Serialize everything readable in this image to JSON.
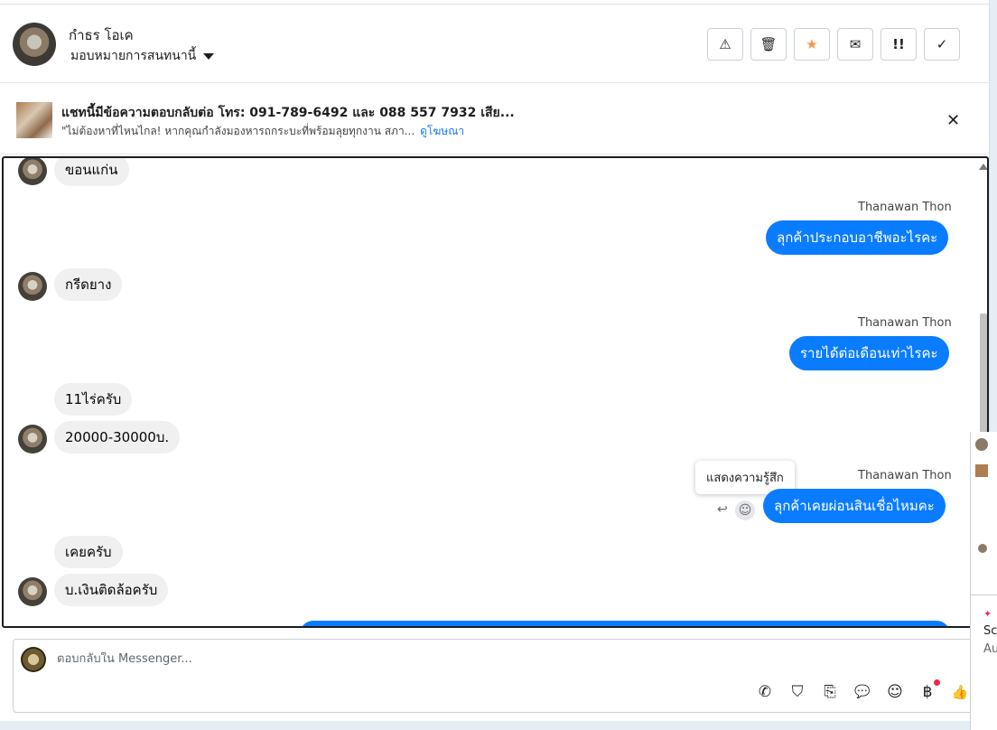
{
  "header": {
    "name": "กำธร โอเค",
    "assign_label": "มอบหมายการสนทนานี้",
    "actions": [
      {
        "icon": "warning-icon",
        "glyph": "⚠"
      },
      {
        "icon": "trash-icon",
        "glyph": "🗑"
      },
      {
        "icon": "star-icon",
        "glyph": "★"
      },
      {
        "icon": "envelope-open-icon",
        "glyph": "✉"
      },
      {
        "icon": "exclamation-icon",
        "glyph": "!!"
      },
      {
        "icon": "check-icon",
        "glyph": "✓"
      }
    ]
  },
  "ad": {
    "title": "แชทนี้มีข้อความตอบกลับต่อ โทร: 091-789-6492 และ 088 557 7932 เสีย...",
    "subtitle": "\"ไม่ต้องหาที่ไหนไกล! หากคุณกำลังมองหารถกระบะที่พร้อมลุยทุกงาน สภา...",
    "link": "ดูโฆษณา",
    "close_glyph": "✕"
  },
  "messages": {
    "m1": "ขอนแก่น",
    "sender1": "Thanawan Thon",
    "m2": "ลุกค้าประกอบอาชีพอะไรคะ",
    "m3": "กรีดยาง",
    "sender2": "Thanawan Thon",
    "m4": "รายได้ต่อเดือนเท่าไรคะ",
    "m5": "11ไร่ครับ",
    "m6": "20000-30000บ.",
    "sender3": "Thanawan Thon",
    "tooltip": "แสดงความรู้สึก",
    "m7": "ลุกค้าเคยผ่อนสินเชื่อไหมคะ",
    "m8": "เคยครับ",
    "m9": "บ.เงินติดล้อครับ"
  },
  "composer": {
    "placeholder": "ตอบกลับใน Messenger...",
    "tools": [
      {
        "icon": "phone-add-icon",
        "glyph": "✆"
      },
      {
        "icon": "shopping-bag-icon",
        "glyph": "⛉"
      },
      {
        "icon": "paperclip-icon",
        "glyph": "⎘"
      },
      {
        "icon": "chat-bubble-icon",
        "glyph": "💬"
      },
      {
        "icon": "emoji-icon",
        "glyph": "☺"
      },
      {
        "icon": "baht-icon",
        "glyph": "฿"
      },
      {
        "icon": "thumbs-up-icon",
        "glyph": "👍"
      }
    ]
  },
  "side": {
    "text1": "Sc",
    "text2": "Au"
  }
}
